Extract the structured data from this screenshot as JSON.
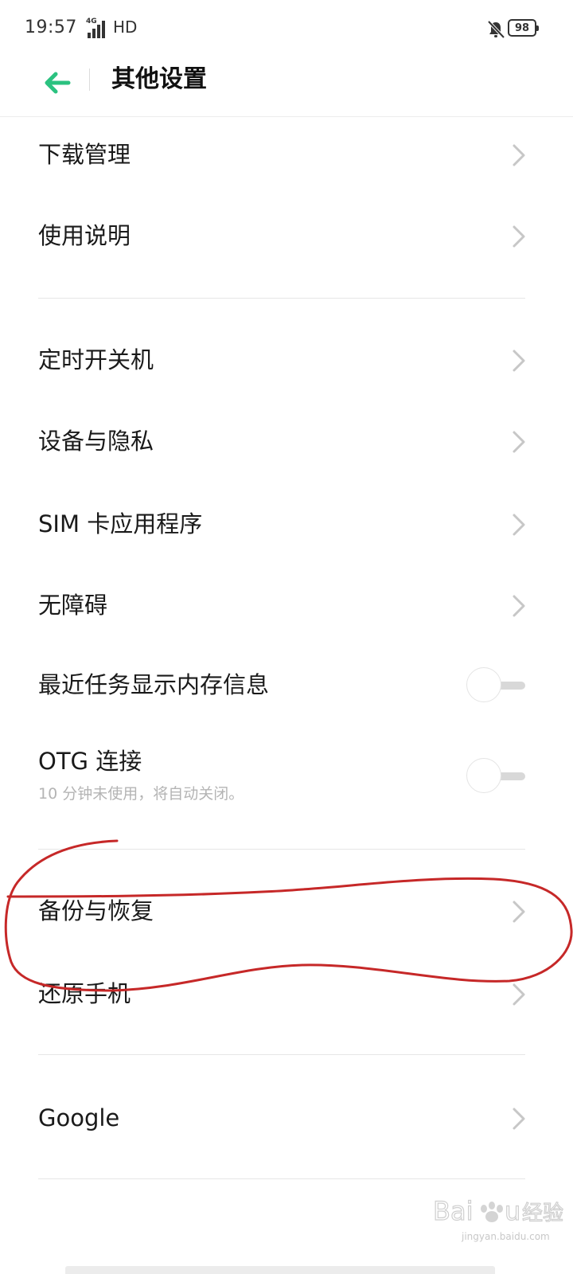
{
  "status_bar": {
    "time": "19:57",
    "network": "4G",
    "hd": "HD",
    "battery": "98"
  },
  "header": {
    "title": "其他设置"
  },
  "items": {
    "download": "下载管理",
    "instructions": "使用说明",
    "schedule_power": "定时开关机",
    "device_privacy": "设备与隐私",
    "sim_apps": "SIM 卡应用程序",
    "accessibility": "无障碍",
    "recent_memory": "最近任务显示内存信息",
    "otg": "OTG 连接",
    "otg_sub": "10 分钟未使用，将自动关闭。",
    "backup": "备份与恢复",
    "reset": "还原手机",
    "google": "Google"
  },
  "toggles": {
    "recent_memory_on": false,
    "otg_on": false
  },
  "colors": {
    "accent": "#2bc280",
    "annotation": "#c62828"
  },
  "watermark": {
    "text": "Baidu经验",
    "sub": "jingyan.baidu.com"
  }
}
